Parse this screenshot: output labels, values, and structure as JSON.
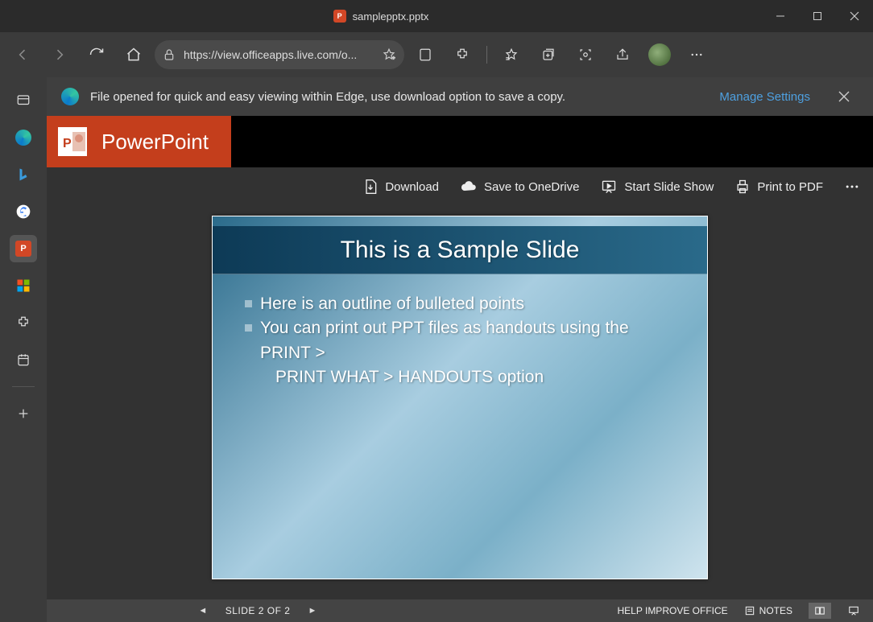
{
  "window": {
    "title": "samplepptx.pptx"
  },
  "address_bar": {
    "url_display": "https://view.officeapps.live.com/o..."
  },
  "info_bar": {
    "text": "File opened for quick and easy viewing within Edge, use download option to save a copy.",
    "manage": "Manage Settings"
  },
  "ppt_brand": "PowerPoint",
  "actions": {
    "download": "Download",
    "onedrive": "Save to OneDrive",
    "slideshow": "Start Slide Show",
    "print": "Print to PDF"
  },
  "slide": {
    "title": "This is a Sample Slide",
    "bullet1": "Here is an outline of bulleted points",
    "bullet2": "You can print out PPT files as handouts using the",
    "line3": "PRINT >",
    "line4": "PRINT WHAT > HANDOUTS option"
  },
  "status": {
    "slide_label": "SLIDE 2 OF 2",
    "help": "HELP IMPROVE OFFICE",
    "notes": "NOTES"
  }
}
